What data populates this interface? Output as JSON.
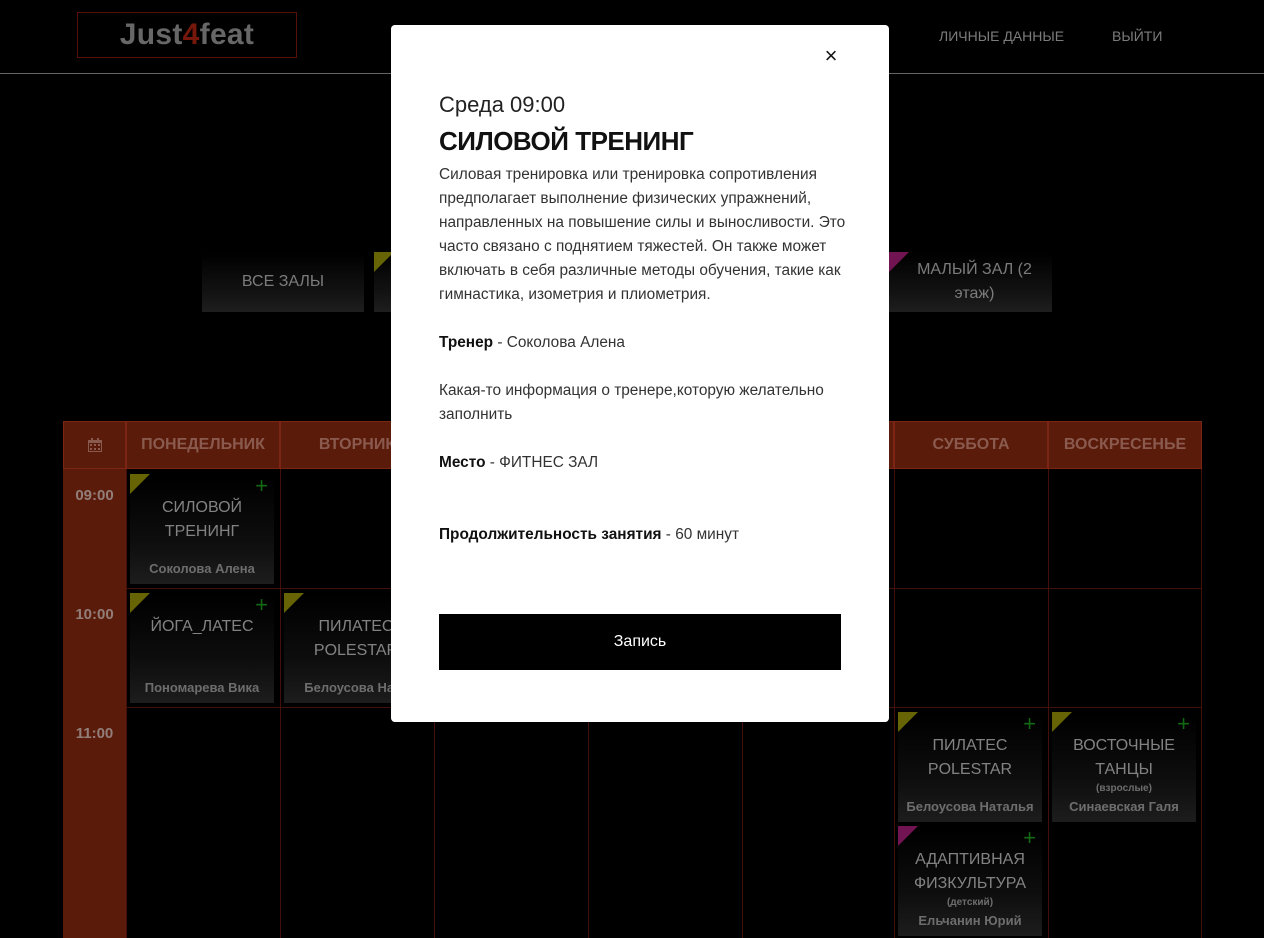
{
  "header": {
    "logo_part1": "Just",
    "logo_part2": "4",
    "logo_part3": "feat",
    "nav": [
      "ЛИЧНЫЕ ДАННЫЕ",
      "ВЫЙТИ"
    ]
  },
  "halls": [
    {
      "label": "ВСЕ ЗАЛЫ",
      "marker": null
    },
    {
      "label": "",
      "marker": "#9d9a09"
    },
    {
      "label": "МАЛЫЙ ЗАЛ (2 этаж)",
      "marker": "#b01f7f"
    }
  ],
  "schedule": {
    "days": [
      "ПОНЕДЕЛЬНИК",
      "ВТОРНИК",
      "",
      "",
      "",
      "СУББОТА",
      "ВОСКРЕСЕНЬЕ"
    ],
    "times": [
      "09:00",
      "10:00",
      "11:00"
    ],
    "classes": [
      {
        "title": "СИЛОВОЙ ТРЕНИНГ",
        "trainer": "Соколова Алена",
        "sub": "",
        "marker": "yellow"
      },
      {
        "title": "ЙОГА_ЛАТЕС",
        "trainer": "Пономарева Вика",
        "sub": "",
        "marker": "yellow"
      },
      {
        "title": "ПИЛАТЕС POLESTAR",
        "trainer": "Белоусова Ната",
        "sub": "",
        "marker": "yellow"
      },
      {
        "title": "ПИЛАТЕС POLESTAR",
        "trainer": "Белоусова Наталья",
        "sub": "",
        "marker": "yellow"
      },
      {
        "title": "ВОСТОЧНЫЕ ТАНЦЫ",
        "trainer": "Синаевская Галя",
        "sub": "(взрослые)",
        "marker": "yellow"
      },
      {
        "title": "АДАПТИВНАЯ ФИЗКУЛЬТУРА",
        "trainer": "Ельчанин Юрий",
        "sub": "(детский)",
        "marker": "magenta"
      }
    ]
  },
  "modal": {
    "day_time": "Среда 09:00",
    "title": "СИЛОВОЙ ТРЕНИНГ",
    "description": "Силовая тренировка или тренировка сопротивления предполагает выполнение физических упражнений, направленных на повышение силы и выносливости. Это часто связано с поднятием тяжестей. Он также может включать в себя различные методы обучения, такие как гимнастика, изометрия и плиометрия.",
    "trainer_label": "Тренер",
    "trainer_value": " - Соколова Алена",
    "trainer_info": "Какая-то информация о тренере,которую желательно заполнить",
    "place_label": "Место",
    "place_value": " - ФИТНЕС ЗАЛ",
    "duration_label": "Продолжительность занятия",
    "duration_value": " - 60 минут",
    "button": "Запись",
    "close_symbol": "×"
  },
  "colors": {
    "header_cell": "#8a2a10",
    "marker_yellow": "#9d9a09",
    "marker_magenta": "#b01f7f",
    "plus_green": "#1ea01e"
  }
}
